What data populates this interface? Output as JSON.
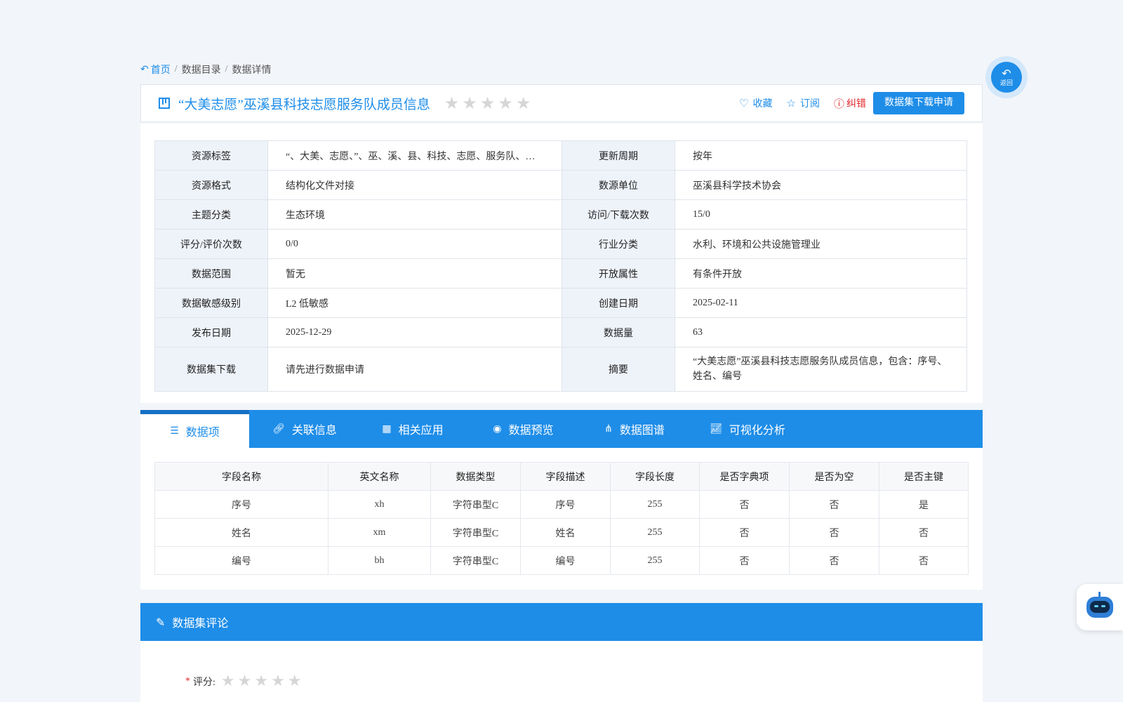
{
  "breadcrumb": {
    "home": "首页",
    "items": [
      "数据目录",
      "数据详情"
    ]
  },
  "title": "“大美志愿”巫溪县科技志愿服务队成员信息",
  "title_rating_stars": 0,
  "actions": {
    "favorite": "收藏",
    "subscribe": "订阅",
    "error": "纠错",
    "apply": "数据集下载申请"
  },
  "back_label": "返回",
  "info": {
    "rows": [
      {
        "k1": "资源标签",
        "v1": "“、大美、志愿、”、巫、溪、县、科技、志愿、服务队、成员、信息",
        "k2": "更新周期",
        "v2": "按年"
      },
      {
        "k1": "资源格式",
        "v1": "结构化文件对接",
        "k2": "数源单位",
        "v2": "巫溪县科学技术协会"
      },
      {
        "k1": "主题分类",
        "v1": "生态环境",
        "k2": "访问/下载次数",
        "v2": "15/0"
      },
      {
        "k1": "评分/评价次数",
        "v1": "0/0",
        "k2": "行业分类",
        "v2": "水利、环境和公共设施管理业"
      },
      {
        "k1": "数据范围",
        "v1": "暂无",
        "k2": "开放属性",
        "v2": "有条件开放"
      },
      {
        "k1": "数据敏感级别",
        "v1": "L2 低敏感",
        "k2": "创建日期",
        "v2": "2025-02-11"
      },
      {
        "k1": "发布日期",
        "v1": "2025-12-29",
        "k2": "数据量",
        "v2": "63"
      },
      {
        "k1": "数据集下载",
        "v1": "请先进行数据申请",
        "k2": "摘要",
        "v2": "“大美志愿”巫溪县科技志愿服务队成员信息，包含：序号、姓名、编号"
      }
    ]
  },
  "tabs": [
    "数据项",
    "关联信息",
    "相关应用",
    "数据预览",
    "数据图谱",
    "可视化分析"
  ],
  "fields": {
    "headers": [
      "字段名称",
      "英文名称",
      "数据类型",
      "字段描述",
      "字段长度",
      "是否字典项",
      "是否为空",
      "是否主键"
    ],
    "rows": [
      [
        "序号",
        "xh",
        "字符串型C",
        "序号",
        "255",
        "否",
        "否",
        "是"
      ],
      [
        "姓名",
        "xm",
        "字符串型C",
        "姓名",
        "255",
        "否",
        "否",
        "否"
      ],
      [
        "编号",
        "bh",
        "字符串型C",
        "编号",
        "255",
        "否",
        "否",
        "否"
      ]
    ]
  },
  "comments": {
    "header": "数据集评论",
    "rating_required_mark": "*",
    "rating_label": "评分:",
    "rating_stars": 0
  },
  "colors": {
    "accent": "#1e8de8",
    "error": "#e0262b",
    "star_empty": "#d6d6d6"
  }
}
